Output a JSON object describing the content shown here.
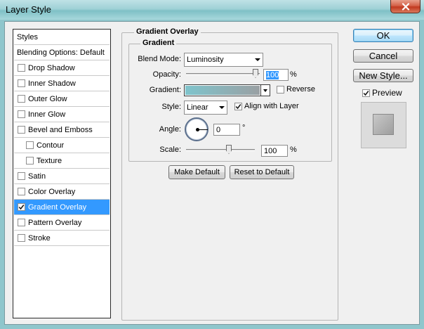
{
  "window": {
    "title": "Layer Style"
  },
  "styles_panel": {
    "header": "Styles",
    "blending_options": "Blending Options: Default",
    "items": [
      {
        "label": "Drop Shadow",
        "checked": false,
        "indent": false,
        "selected": false
      },
      {
        "label": "Inner Shadow",
        "checked": false,
        "indent": false,
        "selected": false
      },
      {
        "label": "Outer Glow",
        "checked": false,
        "indent": false,
        "selected": false
      },
      {
        "label": "Inner Glow",
        "checked": false,
        "indent": false,
        "selected": false
      },
      {
        "label": "Bevel and Emboss",
        "checked": false,
        "indent": false,
        "selected": false
      },
      {
        "label": "Contour",
        "checked": false,
        "indent": true,
        "selected": false
      },
      {
        "label": "Texture",
        "checked": false,
        "indent": true,
        "selected": false
      },
      {
        "label": "Satin",
        "checked": false,
        "indent": false,
        "selected": false
      },
      {
        "label": "Color Overlay",
        "checked": false,
        "indent": false,
        "selected": false
      },
      {
        "label": "Gradient Overlay",
        "checked": true,
        "indent": false,
        "selected": true
      },
      {
        "label": "Pattern Overlay",
        "checked": false,
        "indent": false,
        "selected": false
      },
      {
        "label": "Stroke",
        "checked": false,
        "indent": false,
        "selected": false
      }
    ]
  },
  "gradient_overlay": {
    "section_title": "Gradient Overlay",
    "group_title": "Gradient",
    "blend_mode": {
      "label": "Blend Mode:",
      "value": "Luminosity"
    },
    "opacity": {
      "label": "Opacity:",
      "value": "100",
      "unit": "%",
      "level": 1.0
    },
    "gradient": {
      "label": "Gradient:",
      "color_start": "#7fc4cc",
      "color_end": "#9aa0a3"
    },
    "reverse": {
      "label": "Reverse",
      "checked": false
    },
    "style": {
      "label": "Style:",
      "value": "Linear"
    },
    "align_with_layer": {
      "label": "Align with Layer",
      "checked": true
    },
    "angle": {
      "label": "Angle:",
      "value": "0",
      "unit": "°"
    },
    "scale": {
      "label": "Scale:",
      "value": "100",
      "unit": "%",
      "level": 0.6
    },
    "make_default": "Make Default",
    "reset_to_default": "Reset to Default"
  },
  "actions": {
    "ok": "OK",
    "cancel": "Cancel",
    "new_style": "New Style...",
    "preview": {
      "label": "Preview",
      "checked": true
    }
  },
  "icons": {
    "close": "close-icon",
    "check": "checkmark-icon"
  },
  "colors": {
    "selection": "#3399ff",
    "titlebar": "#9fd1d6",
    "close_button": "#c1391f"
  }
}
